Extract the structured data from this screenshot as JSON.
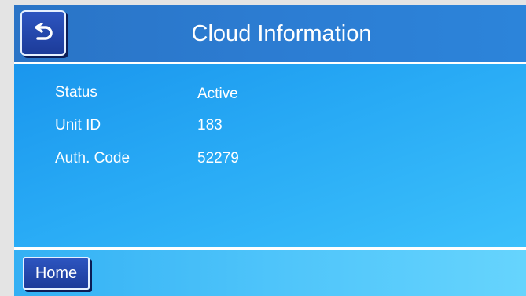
{
  "header": {
    "title": "Cloud Information",
    "back_icon": "back-arrow-icon"
  },
  "info": [
    {
      "label": "Status",
      "value": "Active"
    },
    {
      "label": "Unit ID",
      "value": "183"
    },
    {
      "label": "Auth. Code",
      "value": "52279"
    }
  ],
  "footer": {
    "home_label": "Home"
  },
  "colors": {
    "header": "#2c7dd3",
    "button": "#1f3fa6",
    "panel": "#28aaf5",
    "footer": "#4ec4fa",
    "text": "#ffffff"
  }
}
